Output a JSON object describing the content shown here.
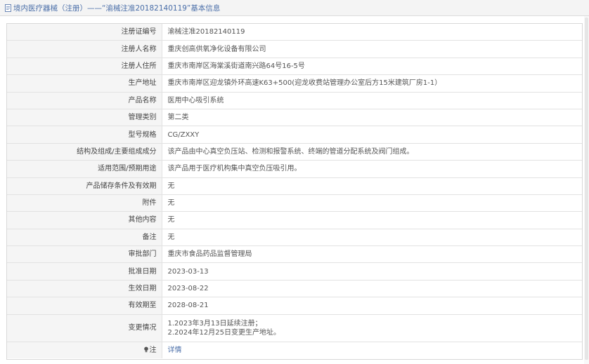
{
  "header": {
    "icon": "document-icon",
    "title": "境内医疗器械（注册）——“渝械注准20182140119”基本信息"
  },
  "rows": [
    {
      "label": "注册证编号",
      "value": "渝械注准20182140119"
    },
    {
      "label": "注册人名称",
      "value": "重庆创高供氧净化设备有限公司"
    },
    {
      "label": "注册人住所",
      "value": "重庆市南岸区海棠溪街道南兴路64号16-5号"
    },
    {
      "label": "生产地址",
      "value": "重庆市南岸区迎龙镇外环高速K63+500(迎龙收费站管理办公室后方15米建筑厂房1-1）"
    },
    {
      "label": "产品名称",
      "value": "医用中心吸引系统"
    },
    {
      "label": "管理类别",
      "value": "第二类"
    },
    {
      "label": "型号规格",
      "value": "CG/ZXXY"
    },
    {
      "label": "结构及组成/主要组成成分",
      "value": "该产品由中心真空负压站、检测和报警系统、终端的管道分配系统及阀门组成。"
    },
    {
      "label": "适用范围/预期用途",
      "value": "该产品用于医疗机构集中真空负压吸引用。"
    },
    {
      "label": "产品储存条件及有效期",
      "value": "无"
    },
    {
      "label": "附件",
      "value": "无"
    },
    {
      "label": "其他内容",
      "value": "无"
    },
    {
      "label": "备注",
      "value": "无"
    },
    {
      "label": "审批部门",
      "value": "重庆市食品药品监督管理局"
    },
    {
      "label": "批准日期",
      "value": "2023-03-13"
    },
    {
      "label": "生效日期",
      "value": "2023-08-22"
    },
    {
      "label": "有效期至",
      "value": "2028-08-21"
    }
  ],
  "change_row": {
    "label": "变更情况",
    "lines": [
      "1.2023年3月13日延续注册；",
      "2.2024年12月25日变更生产地址。"
    ]
  },
  "note_row": {
    "icon": "lightbulb-icon",
    "label": "注",
    "link": "详情"
  },
  "colors": {
    "link": "#4a6ea8",
    "label_bg": "#f5f5f5",
    "border": "#e2e2e2"
  }
}
